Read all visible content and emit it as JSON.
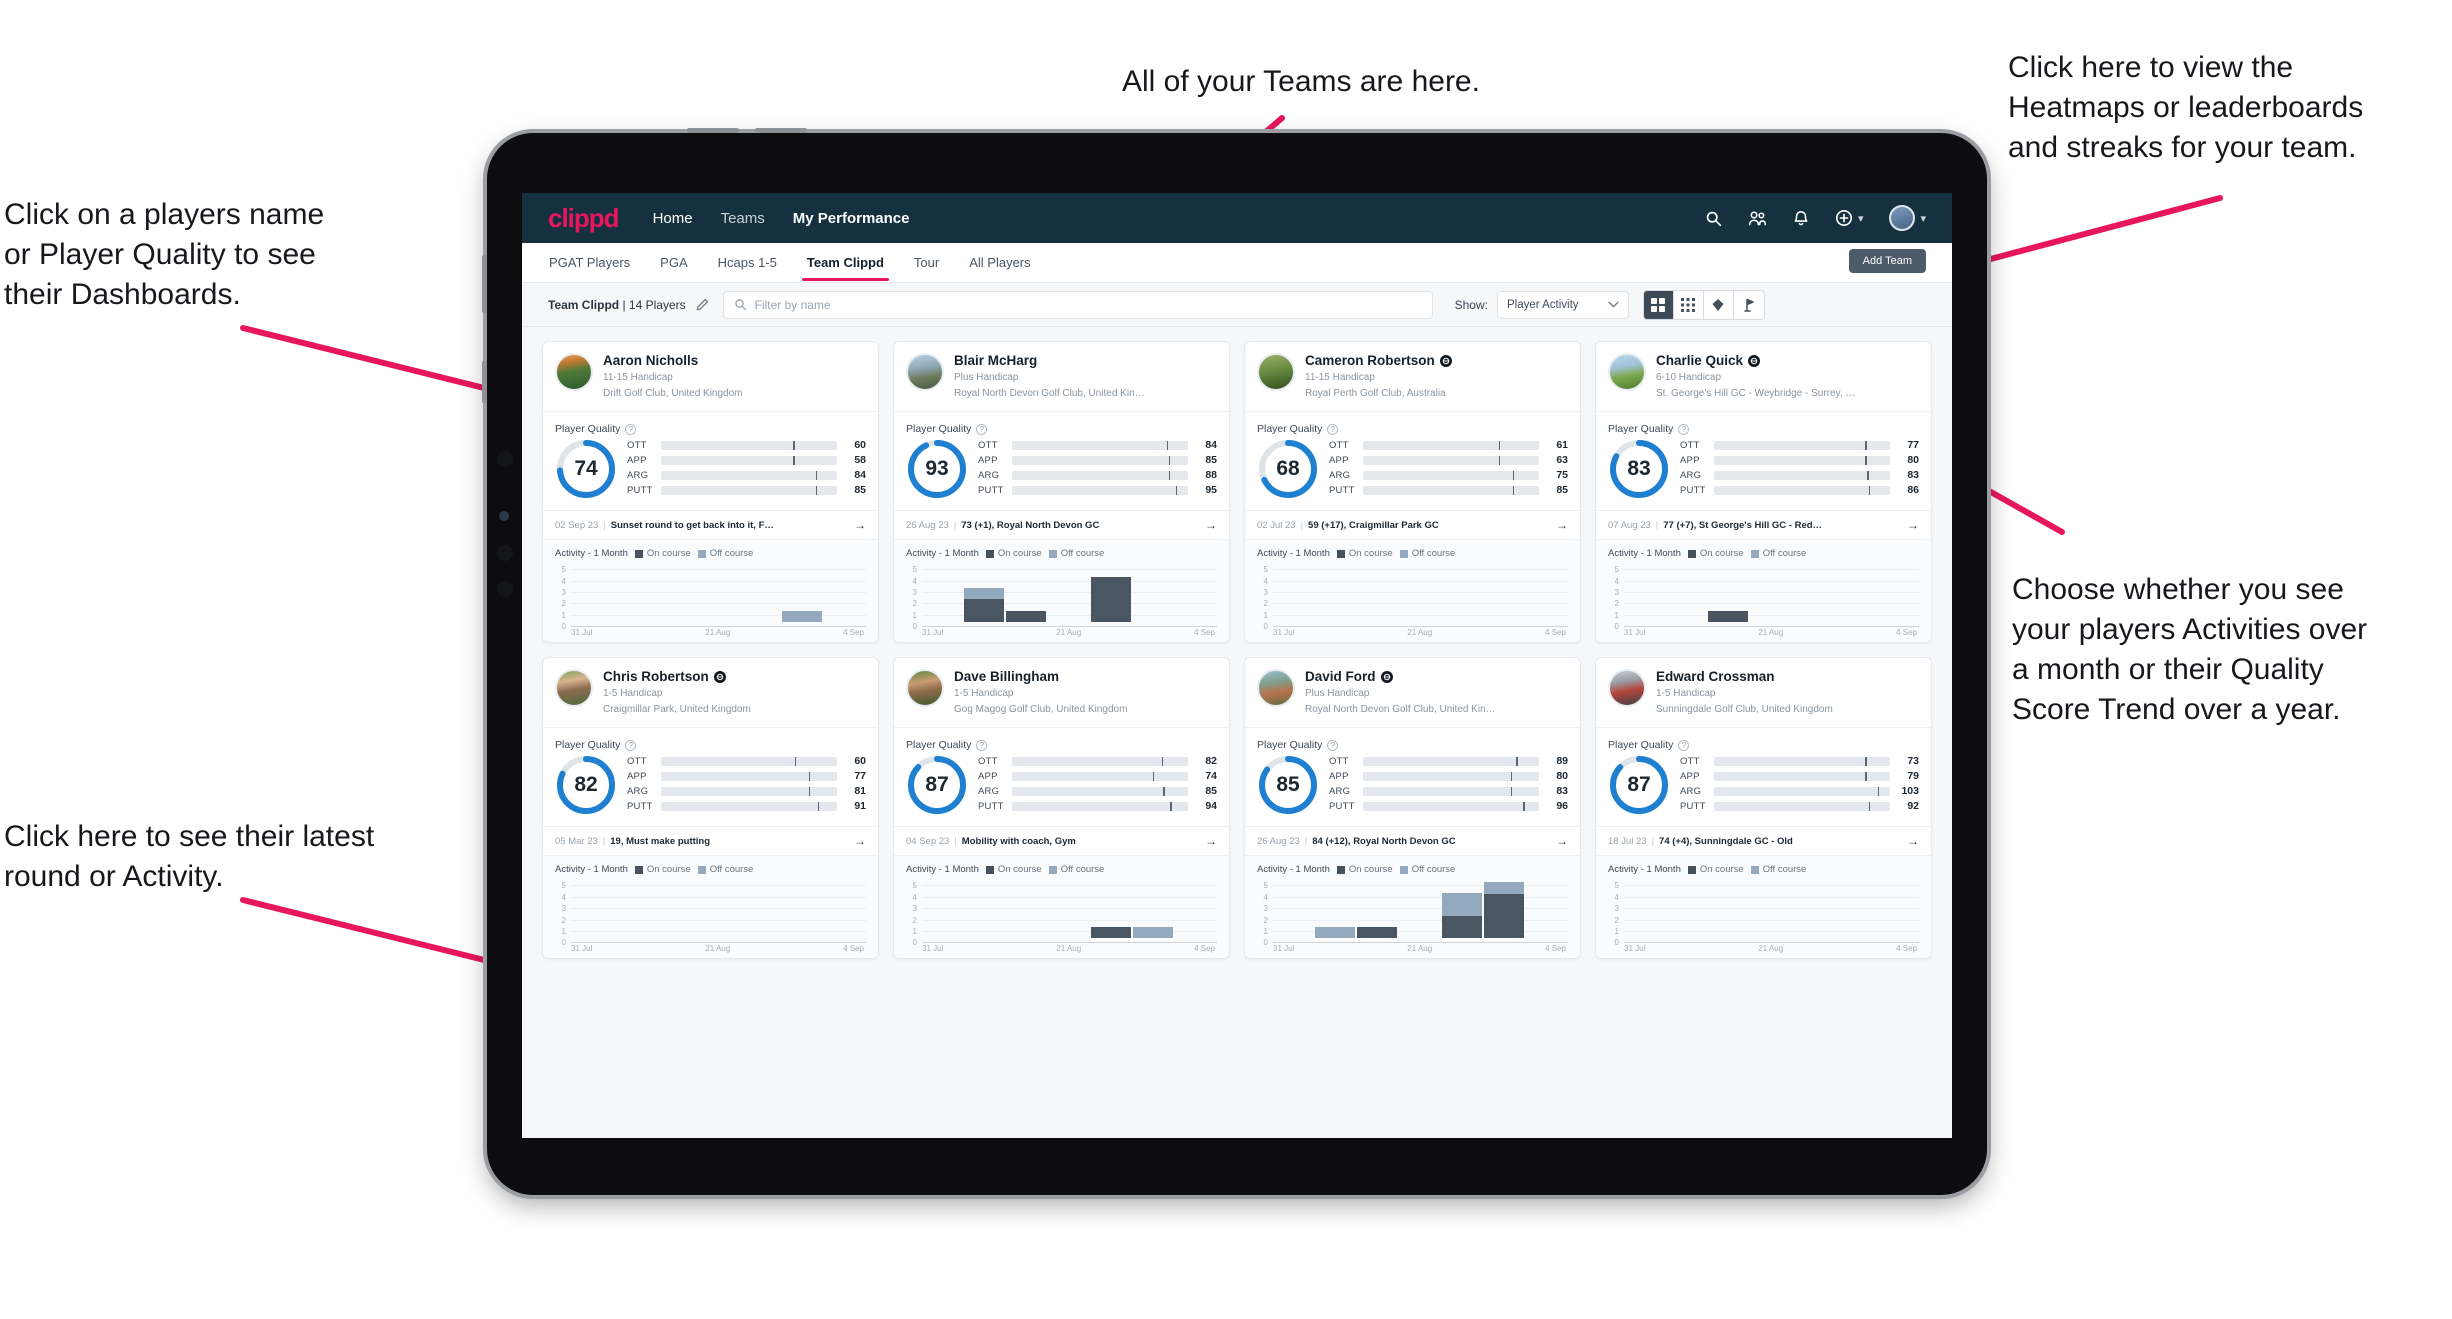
{
  "annotations": [
    {
      "id": "teams",
      "text": "All of your Teams are here."
    },
    {
      "id": "heatmaps",
      "text": "Click here to view the\nHeatmaps or leaderboards\nand streaks for your team."
    },
    {
      "id": "player-name",
      "text": "Click on a players name\nor Player Quality to see\ntheir Dashboards."
    },
    {
      "id": "activity-choice",
      "text": "Choose whether you see\nyour players Activities over\na month or their Quality\nScore Trend over a year."
    },
    {
      "id": "latest-round",
      "text": "Click here to see their latest\nround or Activity."
    }
  ],
  "header": {
    "logo": "clippd",
    "nav": [
      {
        "label": "Home",
        "active": true
      },
      {
        "label": "Teams",
        "active": false
      },
      {
        "label": "My Performance",
        "active": true
      }
    ],
    "icons": [
      "search-icon",
      "people-icon",
      "bell-icon",
      "plus-circle-icon",
      "avatar"
    ]
  },
  "tabstrip": {
    "tabs": [
      {
        "label": "PGAT Players",
        "selected": false
      },
      {
        "label": "PGA",
        "selected": false
      },
      {
        "label": "Hcaps 1-5",
        "selected": false
      },
      {
        "label": "Team Clippd",
        "selected": true
      },
      {
        "label": "Tour",
        "selected": false
      },
      {
        "label": "All Players",
        "selected": false
      }
    ],
    "add_team_label": "Add Team"
  },
  "filterbar": {
    "team_name": "Team Clippd",
    "team_count": "| 14 Players",
    "search_placeholder": "Filter by name",
    "search_value": "",
    "show_label": "Show:",
    "show_value": "Player Activity",
    "view_buttons": [
      "grid-large-icon",
      "grid-small-icon",
      "heatmap-icon",
      "flag-icon"
    ],
    "active_view": 0
  },
  "colors": {
    "accent": "#e8175d",
    "header_bg": "#15313f",
    "ott": "#f5a300",
    "app": "#3ddcb0",
    "arg": "#f5004f",
    "putt": "#b500c4",
    "ring": "#1f7fd0",
    "on_course": "#4a5763",
    "off_course": "#93a9bd"
  },
  "quality_legend": {
    "title": "Player Quality",
    "help": "?"
  },
  "activity_legend": {
    "title": "Activity - 1 Month",
    "on": "On course",
    "off": "Off course"
  },
  "chart_data": {
    "type": "bar",
    "title": "Activity - 1 Month",
    "ylim": [
      0,
      5
    ],
    "yticks": [
      5,
      4,
      3,
      2,
      1,
      0
    ],
    "xticks": [
      "31 Jul",
      "21 Aug",
      "4 Sep"
    ],
    "series_names": [
      "On course",
      "Off course"
    ],
    "grid": true,
    "legend": "top"
  },
  "players": [
    {
      "name": "Aaron Nicholls",
      "verified": false,
      "handicap": "11-15 Handicap",
      "club": "Drift Golf Club, United Kingdom",
      "avatar": "linear-gradient(170deg,#e8a06a 0%,#c5792f 22%,#4d7a3a 48%,#2f5c2a 100%)",
      "quality": 74,
      "metrics": [
        {
          "label": "OTT",
          "value": 60,
          "fill": 58,
          "tick": 75
        },
        {
          "label": "APP",
          "value": 58,
          "fill": 55,
          "tick": 75
        },
        {
          "label": "ARG",
          "value": 84,
          "fill": 80,
          "tick": 88
        },
        {
          "label": "PUTT",
          "value": 85,
          "fill": 80,
          "tick": 88
        }
      ],
      "round_date": "02 Sep 23",
      "round_text": "Sunset round to get back into it, F…",
      "activity": [
        {
          "on": 0,
          "off": 0
        },
        {
          "on": 0,
          "off": 0
        },
        {
          "on": 0,
          "off": 0
        },
        {
          "on": 0,
          "off": 0
        },
        {
          "on": 0,
          "off": 0
        },
        {
          "on": 0,
          "off": 1
        },
        {
          "on": 0,
          "off": 0
        }
      ]
    },
    {
      "name": "Blair McHarg",
      "verified": false,
      "handicap": "Plus Handicap",
      "club": "Royal North Devon Golf Club, United Kin…",
      "avatar": "linear-gradient(170deg,#b9cfe0 0%,#8fa8b8 38%,#6f7e62 62%,#4a5a3d 100%)",
      "quality": 93,
      "metrics": [
        {
          "label": "OTT",
          "value": 84,
          "fill": 80,
          "tick": 88
        },
        {
          "label": "APP",
          "value": 85,
          "fill": 83,
          "tick": 89
        },
        {
          "label": "ARG",
          "value": 88,
          "fill": 83,
          "tick": 89
        },
        {
          "label": "PUTT",
          "value": 95,
          "fill": 89,
          "tick": 93
        }
      ],
      "round_date": "26 Aug 23",
      "round_text": "73 (+1), Royal North Devon GC",
      "activity": [
        {
          "on": 0,
          "off": 0
        },
        {
          "on": 2,
          "off": 1
        },
        {
          "on": 1,
          "off": 0
        },
        {
          "on": 0,
          "off": 0
        },
        {
          "on": 4,
          "off": 0
        },
        {
          "on": 0,
          "off": 0
        },
        {
          "on": 0,
          "off": 0
        }
      ]
    },
    {
      "name": "Cameron Robertson",
      "verified": true,
      "handicap": "11-15 Handicap",
      "club": "Royal Perth Golf Club, Australia",
      "avatar": "linear-gradient(170deg,#9bb06a 0%,#6f8f45 40%,#4d7030 70%,#36521f 100%)",
      "quality": 68,
      "metrics": [
        {
          "label": "OTT",
          "value": 61,
          "fill": 58,
          "tick": 77
        },
        {
          "label": "APP",
          "value": 63,
          "fill": 55,
          "tick": 77
        },
        {
          "label": "ARG",
          "value": 75,
          "fill": 72,
          "tick": 85
        },
        {
          "label": "PUTT",
          "value": 85,
          "fill": 78,
          "tick": 85
        }
      ],
      "round_date": "02 Jul 23",
      "round_text": "59 (+17), Craigmillar Park GC",
      "activity": [
        {
          "on": 0,
          "off": 0
        },
        {
          "on": 0,
          "off": 0
        },
        {
          "on": 0,
          "off": 0
        },
        {
          "on": 0,
          "off": 0
        },
        {
          "on": 0,
          "off": 0
        },
        {
          "on": 0,
          "off": 0
        },
        {
          "on": 0,
          "off": 0
        }
      ]
    },
    {
      "name": "Charlie Quick",
      "verified": true,
      "handicap": "6-10 Handicap",
      "club": "St. George's Hill GC - Weybridge - Surrey, …",
      "avatar": "linear-gradient(170deg,#bcd7ea 0%,#9fc2da 34%,#7ea84f 60%,#4f7c33 100%)",
      "quality": 83,
      "metrics": [
        {
          "label": "OTT",
          "value": 77,
          "fill": 74,
          "tick": 86
        },
        {
          "label": "APP",
          "value": 80,
          "fill": 75,
          "tick": 86
        },
        {
          "label": "ARG",
          "value": 83,
          "fill": 77,
          "tick": 87
        },
        {
          "label": "PUTT",
          "value": 86,
          "fill": 78,
          "tick": 88
        }
      ],
      "round_date": "07 Aug 23",
      "round_text": "77 (+7), St George's Hill GC - Red…",
      "activity": [
        {
          "on": 0,
          "off": 0
        },
        {
          "on": 0,
          "off": 0
        },
        {
          "on": 1,
          "off": 0
        },
        {
          "on": 0,
          "off": 0
        },
        {
          "on": 0,
          "off": 0
        },
        {
          "on": 0,
          "off": 0
        },
        {
          "on": 0,
          "off": 0
        }
      ]
    },
    {
      "name": "Chris Robertson",
      "verified": true,
      "handicap": "1-5 Handicap",
      "club": "Craigmillar Park, United Kingdom",
      "avatar": "linear-gradient(170deg,#7fa45c 0%,#d8b48e 30%,#8a6a4e 55%,#4f6b3c 100%)",
      "quality": 82,
      "metrics": [
        {
          "label": "OTT",
          "value": 60,
          "fill": 58,
          "tick": 76
        },
        {
          "label": "APP",
          "value": 77,
          "fill": 72,
          "tick": 84
        },
        {
          "label": "ARG",
          "value": 81,
          "fill": 73,
          "tick": 84
        },
        {
          "label": "PUTT",
          "value": 91,
          "fill": 84,
          "tick": 89
        }
      ],
      "round_date": "05 Mar 23",
      "round_text": "19, Must make putting",
      "activity": [
        {
          "on": 0,
          "off": 0
        },
        {
          "on": 0,
          "off": 0
        },
        {
          "on": 0,
          "off": 0
        },
        {
          "on": 0,
          "off": 0
        },
        {
          "on": 0,
          "off": 0
        },
        {
          "on": 0,
          "off": 0
        },
        {
          "on": 0,
          "off": 0
        }
      ]
    },
    {
      "name": "Dave Billingham",
      "verified": false,
      "handicap": "1-5 Handicap",
      "club": "Gog Magog Golf Club, United Kingdom",
      "avatar": "linear-gradient(170deg,#5d8a3f 0%,#c89b72 34%,#8d6a4a 58%,#3e5c2c 100%)",
      "quality": 87,
      "metrics": [
        {
          "label": "OTT",
          "value": 82,
          "fill": 76,
          "tick": 85
        },
        {
          "label": "APP",
          "value": 74,
          "fill": 68,
          "tick": 80
        },
        {
          "label": "ARG",
          "value": 85,
          "fill": 77,
          "tick": 86
        },
        {
          "label": "PUTT",
          "value": 94,
          "fill": 86,
          "tick": 90
        }
      ],
      "round_date": "04 Sep 23",
      "round_text": "Mobility with coach, Gym",
      "activity": [
        {
          "on": 0,
          "off": 0
        },
        {
          "on": 0,
          "off": 0
        },
        {
          "on": 0,
          "off": 0
        },
        {
          "on": 0,
          "off": 0
        },
        {
          "on": 1,
          "off": 0
        },
        {
          "on": 0,
          "off": 1
        },
        {
          "on": 0,
          "off": 0
        }
      ]
    },
    {
      "name": "David Ford",
      "verified": true,
      "handicap": "Plus Handicap",
      "club": "Royal North Devon Golf Club, United Kin…",
      "avatar": "linear-gradient(170deg,#9ec0d6 0%,#7fa08c 34%,#b8724d 62%,#5d7043 100%)",
      "quality": 85,
      "metrics": [
        {
          "label": "OTT",
          "value": 89,
          "fill": 82,
          "tick": 87
        },
        {
          "label": "APP",
          "value": 80,
          "fill": 74,
          "tick": 84
        },
        {
          "label": "ARG",
          "value": 83,
          "fill": 74,
          "tick": 84
        },
        {
          "label": "PUTT",
          "value": 96,
          "fill": 88,
          "tick": 91
        }
      ],
      "round_date": "26 Aug 23",
      "round_text": "84 (+12), Royal North Devon GC",
      "activity": [
        {
          "on": 0,
          "off": 0
        },
        {
          "on": 0,
          "off": 1
        },
        {
          "on": 1,
          "off": 0
        },
        {
          "on": 0,
          "off": 0
        },
        {
          "on": 2,
          "off": 2
        },
        {
          "on": 4,
          "off": 1
        },
        {
          "on": 0,
          "off": 0
        }
      ]
    },
    {
      "name": "Edward Crossman",
      "verified": false,
      "handicap": "1-5 Handicap",
      "club": "Sunningdale Golf Club, United Kingdom",
      "avatar": "linear-gradient(170deg,#c9ced4 0%,#9aa1a9 30%,#b4443a 58%,#3c4248 100%)",
      "quality": 87,
      "metrics": [
        {
          "label": "OTT",
          "value": 73,
          "fill": 68,
          "tick": 86
        },
        {
          "label": "APP",
          "value": 79,
          "fill": 72,
          "tick": 86
        },
        {
          "label": "ARG",
          "value": 103,
          "fill": 86,
          "tick": 93
        },
        {
          "label": "PUTT",
          "value": 92,
          "fill": 82,
          "tick": 88
        }
      ],
      "round_date": "18 Jul 23",
      "round_text": "74 (+4), Sunningdale GC - Old",
      "activity": [
        {
          "on": 0,
          "off": 0
        },
        {
          "on": 0,
          "off": 0
        },
        {
          "on": 0,
          "off": 0
        },
        {
          "on": 0,
          "off": 0
        },
        {
          "on": 0,
          "off": 0
        },
        {
          "on": 0,
          "off": 0
        },
        {
          "on": 0,
          "off": 0
        }
      ]
    }
  ]
}
